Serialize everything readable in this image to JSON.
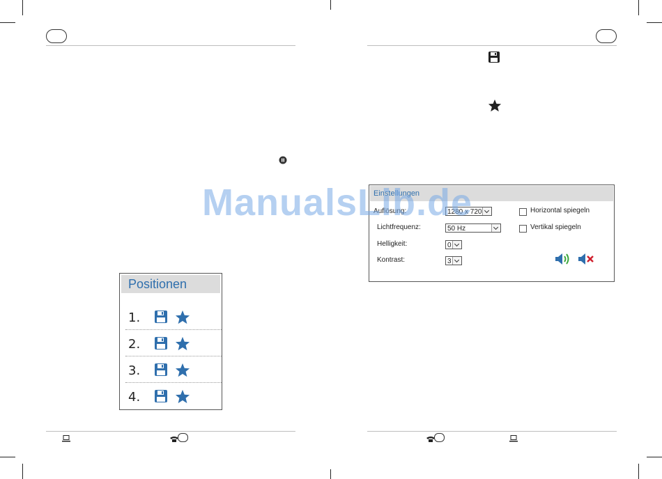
{
  "positions_panel": {
    "title": "Positionen",
    "rows": [
      {
        "number": "1."
      },
      {
        "number": "2."
      },
      {
        "number": "3."
      },
      {
        "number": "4."
      }
    ],
    "save_icon": "floppy-disk-icon",
    "favorite_icon": "star-icon"
  },
  "settings_panel": {
    "title": "Einstellungen",
    "resolution": {
      "label": "Auflösung:",
      "value": "1280 x 720"
    },
    "light_frequency": {
      "label": "Lichtfrequenz:",
      "value": "50 Hz"
    },
    "brightness": {
      "label": "Helligkeit:",
      "value": "0"
    },
    "contrast": {
      "label": "Kontrast:",
      "value": "3"
    },
    "flip_horizontal": {
      "label": "Horizontal spiegeln",
      "checked": false
    },
    "flip_vertical": {
      "label": "Vertikal spiegeln",
      "checked": false
    },
    "audio_on_icon": "speaker-on-icon",
    "audio_off_icon": "speaker-mute-icon"
  },
  "watermark": "ManualsLib.de",
  "colors": {
    "accent_blue": "#2f6fad",
    "header_gray": "#dcdcdc",
    "sound_green": "#3aa63a",
    "mute_red": "#d0202e"
  },
  "icons": {
    "right_page_top_icon": "floppy-disk-icon",
    "right_page_second_icon": "star-icon",
    "left_page_small_icon": "pause-circle-icon",
    "footer_icons": [
      "computer-icon",
      "phone-icon"
    ]
  }
}
